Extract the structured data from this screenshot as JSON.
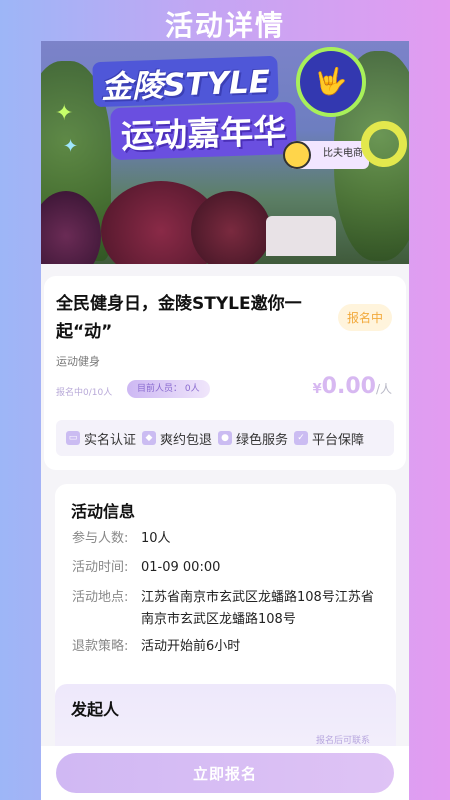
{
  "page_title": "活动详情",
  "banner": {
    "line1": "金陵STYLE",
    "line2": "运动嘉年华",
    "mascot_text": "比夫电商"
  },
  "event": {
    "title": "全民健身日，金陵STYLE邀你一起“动”",
    "status": "报名中",
    "category": "运动健身",
    "signup_count": "报名中0/10人",
    "current_people": "目前人员： 0人",
    "price_currency": "¥",
    "price_amount": "0.00",
    "price_unit": "/人"
  },
  "guarantees": [
    {
      "label": "实名认证",
      "icon": "id-card-icon"
    },
    {
      "label": "爽约包退",
      "icon": "shield-icon"
    },
    {
      "label": "绿色服务",
      "icon": "service-icon"
    },
    {
      "label": "平台保障",
      "icon": "check-shield-icon"
    }
  ],
  "info": {
    "title": "活动信息",
    "rows": [
      {
        "label": "参与人数:",
        "value": "10人"
      },
      {
        "label": "活动时间:",
        "value": "01-09 00:00"
      },
      {
        "label": "活动地点:",
        "value": "江苏省南京市玄武区龙蟠路108号江苏省南京市玄武区龙蟠路108号"
      },
      {
        "label": "退款策略:",
        "value": "活动开始前6小时"
      }
    ]
  },
  "organizer": {
    "title": "发起人",
    "contact_note": "报名后可联系"
  },
  "actions": {
    "signup_label": "立即报名"
  }
}
